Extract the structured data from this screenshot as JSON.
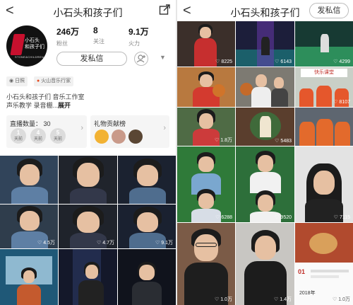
{
  "profile": {
    "back_glyph": "<",
    "name": "小石头和孩子们",
    "avatar_lines": [
      "小石头",
      "和孩子们",
      "STONE&CHILDREN"
    ],
    "stats": [
      {
        "value": "246万",
        "label": "粉丝"
      },
      {
        "value": "8",
        "label": "关注"
      },
      {
        "value": "9.1万",
        "label": "火力"
      }
    ],
    "private_message_label": "发私信",
    "location_tag": "日照",
    "app_tag": "火山音乐行家",
    "bio_line1": "小石头和孩子们 音乐工作室",
    "bio_line2": "声乐教学 录音棚...",
    "bio_more": "展开",
    "live_card": {
      "title": "直播数量：",
      "count": "30",
      "days": [
        {
          "num": "1",
          "label": "天前"
        },
        {
          "num": "4",
          "label": "天前"
        },
        {
          "num": "5",
          "label": "天前"
        }
      ]
    },
    "gift_card": {
      "title": "礼物贡献榜"
    },
    "videos_left": [
      "",
      "",
      "",
      "",
      "4.5万",
      "4.7万",
      "9.1万",
      "",
      "",
      ""
    ]
  },
  "feed": {
    "title": "小石头和孩子们",
    "private_message_label": "发私信",
    "videos": [
      {
        "count": "8225"
      },
      {
        "count": "6143"
      },
      {
        "count": "4299"
      },
      {
        "count": ""
      },
      {
        "count": ""
      },
      {
        "count": "8107"
      },
      {
        "count": "1.8万"
      },
      {
        "count": "5483"
      },
      {
        "count": ""
      },
      {
        "count": "6288"
      },
      {
        "count": "9520"
      },
      {
        "count": "7115"
      },
      {
        "count": "1.0万"
      },
      {
        "count": "1.4万"
      },
      {
        "count": "1.0万"
      }
    ],
    "overlay_texts": {
      "sign": "快乐课堂",
      "year": "2018年",
      "num": "01"
    }
  },
  "icons": {
    "heart": "♡",
    "chevron": "›",
    "caret": "▼"
  }
}
